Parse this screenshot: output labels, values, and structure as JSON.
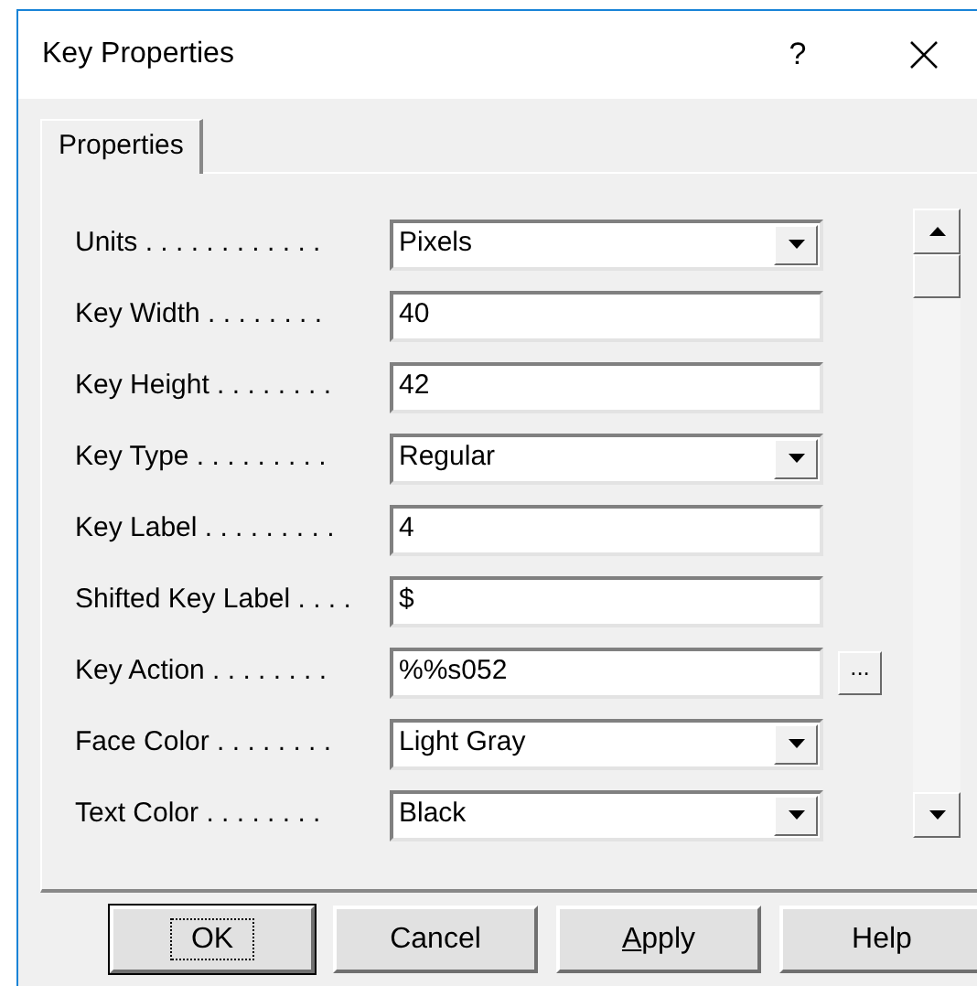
{
  "window": {
    "title": "Key Properties",
    "help_glyph": "?"
  },
  "tabs": [
    {
      "label": "Properties",
      "selected": true
    }
  ],
  "rows": [
    {
      "kind": "dropdown",
      "label": "Units . . . . . . . . . . . .",
      "value": "Pixels"
    },
    {
      "kind": "text",
      "label": "Key Width . . . . . . . .",
      "value": "40"
    },
    {
      "kind": "text",
      "label": "Key Height . . . . . . . .",
      "value": "42"
    },
    {
      "kind": "dropdown",
      "label": "Key Type . . . . . . . . .",
      "value": "Regular"
    },
    {
      "kind": "text",
      "label": "Key Label . . . . . . . . .",
      "value": "4"
    },
    {
      "kind": "text",
      "label": "Shifted Key Label . . . .",
      "value": "$"
    },
    {
      "kind": "browse",
      "label": "Key Action . . . . . . . .",
      "value": "%%s052",
      "button": "..."
    },
    {
      "kind": "dropdown",
      "label": "Face Color . . . . . . . .",
      "value": "Light Gray"
    },
    {
      "kind": "dropdown",
      "label": "Text Color . . . . . . . .",
      "value": "Black"
    }
  ],
  "buttons": [
    {
      "label": "OK",
      "focused": true,
      "underline_first": false
    },
    {
      "label": "Cancel",
      "focused": false,
      "underline_first": false
    },
    {
      "label": "Apply",
      "focused": false,
      "underline_first": true
    },
    {
      "label": "Help",
      "focused": false,
      "underline_first": false
    }
  ]
}
